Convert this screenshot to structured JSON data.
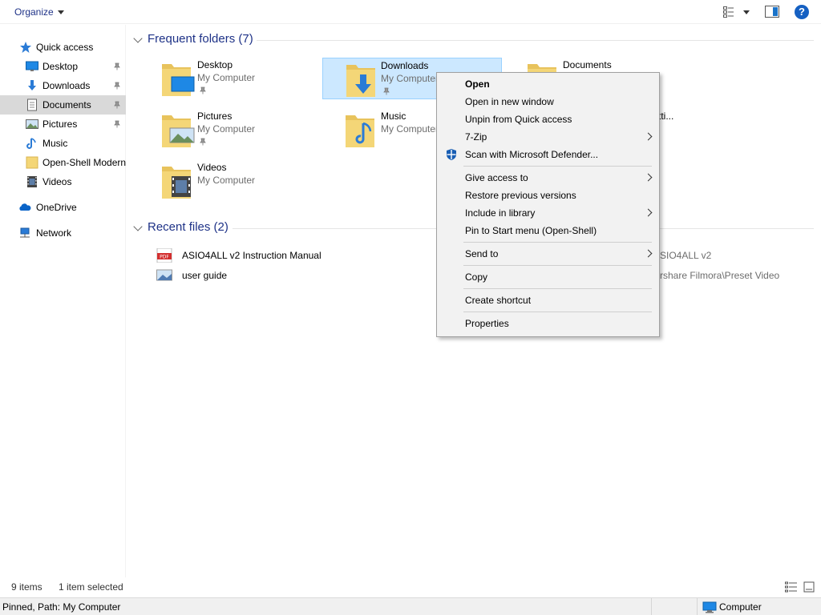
{
  "toolbar": {
    "organize_label": "Organize",
    "view_icon": "change-view-icon",
    "pane_icon": "preview-pane-icon",
    "help_label": "?"
  },
  "nav": {
    "quick_access": "Quick access",
    "items": [
      {
        "label": "Desktop",
        "icon": "desktop-icon",
        "pinned": true
      },
      {
        "label": "Downloads",
        "icon": "downloads-icon",
        "pinned": true
      },
      {
        "label": "Documents",
        "icon": "documents-icon",
        "pinned": true,
        "selected": true
      },
      {
        "label": "Pictures",
        "icon": "pictures-icon",
        "pinned": true
      },
      {
        "label": "Music",
        "icon": "music-icon",
        "pinned": false
      },
      {
        "label": "Open-Shell Modern",
        "icon": "folder-icon",
        "pinned": false
      },
      {
        "label": "Videos",
        "icon": "videos-icon",
        "pinned": false
      }
    ],
    "onedrive": "OneDrive",
    "network": "Network"
  },
  "frequent": {
    "header": "Frequent folders (7)",
    "tiles": [
      {
        "name": "Desktop",
        "sub": "My Computer",
        "pinned": true
      },
      {
        "name": "Downloads",
        "sub": "My Computer",
        "pinned": true,
        "selected": true
      },
      {
        "name": "Documents",
        "sub": "",
        "pinned": false
      },
      {
        "name": "Pictures",
        "sub": "My Computer",
        "pinned": true
      },
      {
        "name": "Music",
        "sub": "My Computer",
        "pinned": false
      },
      {
        "name": "tti...",
        "sub": "",
        "pinned": false
      },
      {
        "name": "Videos",
        "sub": "My Computer",
        "pinned": false
      }
    ]
  },
  "recent": {
    "header": "Recent files (2)",
    "files": [
      {
        "name": "ASIO4ALL v2 Instruction Manual",
        "path": "SIO4ALL v2",
        "icon": "pdf-icon"
      },
      {
        "name": "user guide",
        "path": "rshare Filmora\\Preset Video",
        "icon": "image-file-icon"
      }
    ]
  },
  "context_menu": {
    "items": [
      {
        "label": "Open",
        "bold": true,
        "submenu": false
      },
      {
        "label": "Open in new window",
        "submenu": false
      },
      {
        "label": "Unpin from Quick access",
        "submenu": false
      },
      {
        "label": "7-Zip",
        "submenu": true
      },
      {
        "label": "Scan with Microsoft Defender...",
        "submenu": false,
        "icon": "defender-icon"
      },
      {
        "label": "Give access to",
        "submenu": true
      },
      {
        "label": "Restore previous versions",
        "submenu": false
      },
      {
        "label": "Include in library",
        "submenu": true
      },
      {
        "label": "Pin to Start menu (Open-Shell)",
        "submenu": false
      },
      {
        "label": "Send to",
        "submenu": true
      },
      {
        "label": "Copy",
        "submenu": false
      },
      {
        "label": "Create shortcut",
        "submenu": false
      },
      {
        "label": "Properties",
        "submenu": false
      }
    ]
  },
  "status": {
    "items_count": "9 items",
    "selected": "1 item selected",
    "details": "Pinned, Path: My Computer",
    "location": "Computer"
  },
  "colors": {
    "accent": "#1e3287",
    "selection": "#cce8ff",
    "selection_border": "#99d1ff",
    "folder": "#f4d677"
  }
}
